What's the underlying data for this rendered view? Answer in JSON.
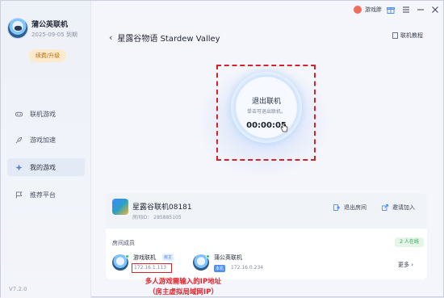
{
  "sidebar": {
    "user_name": "蒲公英联机",
    "expiry": "2025-09-05 到期",
    "renew_label": "续费/升级",
    "nav": [
      {
        "label": "联机游戏",
        "icon": "gamepad-icon"
      },
      {
        "label": "游戏加速",
        "icon": "rocket-icon"
      },
      {
        "label": "我的游戏",
        "icon": "my-games-icon"
      },
      {
        "label": "推荐平台",
        "icon": "flag-icon"
      }
    ],
    "version": "V7.2.0"
  },
  "topbar": {
    "user_label": "游戏胖"
  },
  "header": {
    "title": "星露谷物语 Stardew Valley",
    "tutorial_label": "联机教程"
  },
  "connect": {
    "title": "退出联机",
    "subtitle": "单击可退出联机。",
    "timer": "00:00:05"
  },
  "room": {
    "name": "星露谷联机08181",
    "id": "房间ID： 285885105",
    "exit_label": "退出房间",
    "invite_label": "邀请加入",
    "members_label": "房间成员",
    "online_label": "2 人在线",
    "more_label": "更多",
    "members": [
      {
        "name": "游戏联机",
        "badge": "房主",
        "ip": "172.16.1.113"
      },
      {
        "name": "蒲公英联机",
        "badge": "本机",
        "ip": "172.16.0.234"
      }
    ]
  },
  "annotation": {
    "line1": "多人游戏需输入的IP地址",
    "line2": "（房主虚拟局域网IP）"
  },
  "colors": {
    "accent": "#4f8ef7",
    "annotation": "#e0262d",
    "online": "#2f9e52"
  }
}
